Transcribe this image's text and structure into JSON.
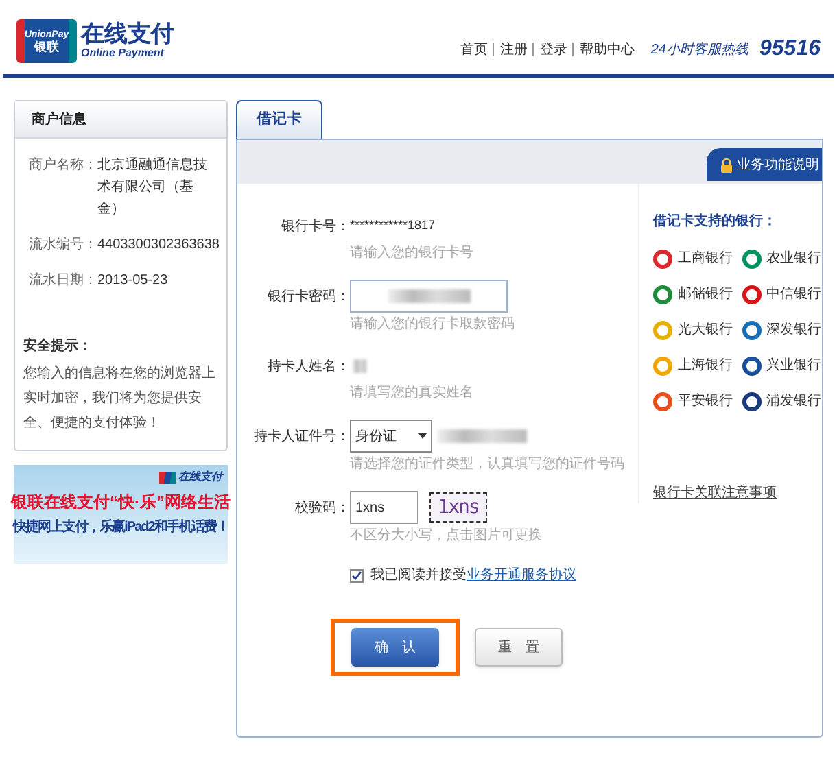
{
  "header": {
    "logo": {
      "mark_top": "UnionPay",
      "mark_bottom": "银联",
      "title": "在线支付",
      "subtitle": "Online Payment"
    },
    "nav": [
      "首页",
      "注册",
      "登录",
      "帮助中心"
    ],
    "hotline_label": "24小时客服热线",
    "hotline_number": "95516"
  },
  "merchant_panel": {
    "title": "商户信息",
    "fields": [
      {
        "label": "商户名称：",
        "value": "北京通融通信息技术有限公司（基金）"
      },
      {
        "label": "流水编号：",
        "value": "4403300302363638"
      },
      {
        "label": "流水日期：",
        "value": "2013-05-23"
      }
    ],
    "security_title": "安全提示：",
    "security_text": "您输入的信息将在您的浏览器上实时加密，我们将为您提供安全、便捷的支付体验！"
  },
  "banner": {
    "logo": "在线支付",
    "headline": "银联在线支付“快·乐”网络生活",
    "subline": "快捷网上支付，乐赢iPad2和手机话费！"
  },
  "tabs": [
    {
      "label": "借记卡",
      "selected": true
    }
  ],
  "help_tab": "业务功能说明",
  "form": [
    {
      "kind": "text",
      "label": "银行卡号：",
      "value": "************1817",
      "hint": "请输入您的银行卡号"
    },
    {
      "kind": "input",
      "label": "银行卡密码：",
      "hint": "请输入您的银行卡取款密码"
    },
    {
      "kind": "redacted",
      "label": "持卡人姓名：",
      "hint": "请填写您的真实姓名"
    },
    {
      "kind": "select",
      "label": "持卡人证件号：",
      "value": "身份证",
      "hint": "请选择您的证件类型，认真填写您的证件号码"
    },
    {
      "kind": "captcha",
      "label": "校验码：",
      "value": "1xns",
      "captcha_text": "1xns",
      "hint": "不区分大小写，点击图片可更换"
    }
  ],
  "agreement": {
    "checked": true,
    "text": "我已阅读并接受",
    "link": "业务开通服务协议"
  },
  "buttons": [
    {
      "label": "确　认",
      "kind": "primary",
      "highlighted": true
    },
    {
      "label": "重　置",
      "kind": "secondary",
      "highlighted": false
    }
  ],
  "banks": {
    "title": "借记卡支持的银行：",
    "items": [
      {
        "name": "工商银行",
        "color": "#d9272e"
      },
      {
        "name": "农业银行",
        "color": "#00935f"
      },
      {
        "name": "邮储银行",
        "color": "#1f8c3b"
      },
      {
        "name": "中信银行",
        "color": "#d7151a"
      },
      {
        "name": "光大银行",
        "color": "#e8b000"
      },
      {
        "name": "深发银行",
        "color": "#1a6fb5"
      },
      {
        "name": "上海银行",
        "color": "#f0a800"
      },
      {
        "name": "兴业银行",
        "color": "#1a4f9c"
      },
      {
        "name": "平安银行",
        "color": "#e8501e"
      },
      {
        "name": "浦发银行",
        "color": "#1a3a7c"
      }
    ],
    "link": "银行卡关联注意事项"
  }
}
